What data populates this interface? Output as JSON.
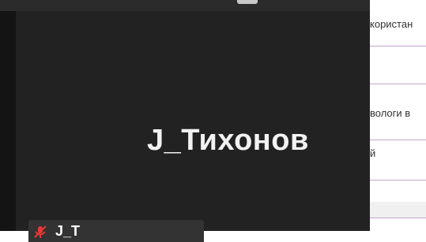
{
  "video": {
    "participant_name": "J_Тихонов",
    "label_text": "J_Т",
    "mic_status_icon": "mic-muted-icon"
  },
  "right_panel": {
    "row1": "користан",
    "row2": "вологи в",
    "row3": "й"
  },
  "colors": {
    "tile_background": "#222222",
    "accent_line": "#c9a3d4",
    "mic_muted": "#e53935"
  }
}
